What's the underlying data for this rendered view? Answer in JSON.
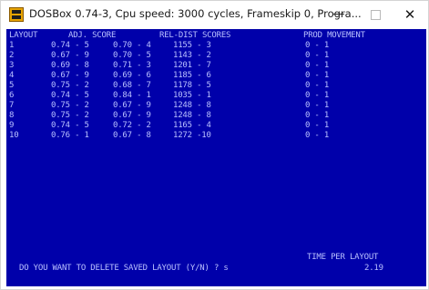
{
  "window": {
    "title": "DOSBox 0.74-3, Cpu speed:    3000 cycles, Frameskip  0, Progra...",
    "minimize_glyph": "—",
    "close_glyph": "✕"
  },
  "colors": {
    "screen_bg": "#0000aa",
    "screen_text": "#b9c0ff"
  },
  "headers": {
    "layout": "LAYOUT",
    "adj_score": "ADJ. SCORE",
    "rel_dist": "REL-DIST",
    "scores": "SCORES",
    "prod_movement": "PROD MOVEMENT"
  },
  "rows": [
    {
      "idx": "1",
      "adj": "0.74 - 5",
      "rel": "0.70 - 4",
      "score": "1155 - 3",
      "prod": "0 - 1"
    },
    {
      "idx": "2",
      "adj": "0.67 - 9",
      "rel": "0.70 - 5",
      "score": "1143 - 2",
      "prod": "0 - 1"
    },
    {
      "idx": "3",
      "adj": "0.69 - 8",
      "rel": "0.71 - 3",
      "score": "1201 - 7",
      "prod": "0 - 1"
    },
    {
      "idx": "4",
      "adj": "0.67 - 9",
      "rel": "0.69 - 6",
      "score": "1185 - 6",
      "prod": "0 - 1"
    },
    {
      "idx": "5",
      "adj": "0.75 - 2",
      "rel": "0.68 - 7",
      "score": "1178 - 5",
      "prod": "0 - 1"
    },
    {
      "idx": "6",
      "adj": "0.74 - 5",
      "rel": "0.84 - 1",
      "score": "1035 - 1",
      "prod": "0 - 1"
    },
    {
      "idx": "7",
      "adj": "0.75 - 2",
      "rel": "0.67 - 9",
      "score": "1248 - 8",
      "prod": "0 - 1"
    },
    {
      "idx": "8",
      "adj": "0.75 - 2",
      "rel": "0.67 - 9",
      "score": "1248 - 8",
      "prod": "0 - 1"
    },
    {
      "idx": "9",
      "adj": "0.74 - 5",
      "rel": "0.72 - 2",
      "score": "1165 - 4",
      "prod": "0 - 1"
    },
    {
      "idx": "10",
      "adj": "0.76 - 1",
      "rel": "0.67 - 8",
      "score": "1272 -10",
      "prod": "0 - 1"
    }
  ],
  "footer": {
    "prompt": "DO YOU WANT TO DELETE SAVED LAYOUT (Y/N) ? s",
    "time_per_layout_label": "TIME PER LAYOUT",
    "time_per_layout_value": "2.19"
  }
}
